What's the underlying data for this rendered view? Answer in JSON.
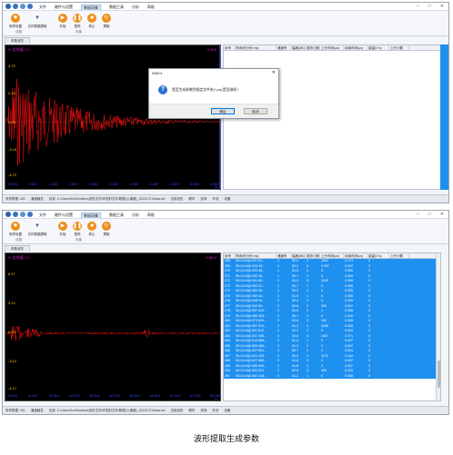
{
  "menus": [
    "文件",
    "硬件与设置",
    "数据采集",
    "数据工具",
    "分析",
    "帮助"
  ],
  "menu_active_index": 2,
  "ribbon_buttons": [
    {
      "label": "采样设置",
      "icon": "gear-icon",
      "color": "#f08c1a"
    },
    {
      "label": "文件数据提取",
      "icon": "filter-icon",
      "color": "#2f5fa8"
    },
    {
      "label": "开始",
      "icon": "play-icon",
      "color": "#f08c1a"
    },
    {
      "label": "暂停",
      "icon": "pause-icon",
      "color": "#f08c1a"
    },
    {
      "label": "停止",
      "icon": "stop-icon",
      "color": "#f08c1a"
    },
    {
      "label": "提取",
      "icon": "extract-icon",
      "color": "#f08c1a"
    }
  ],
  "ribbon_groups": [
    "设置",
    "采集",
    "数据提取"
  ],
  "tab_label": "采集波形",
  "plot1": {
    "legend": "V: 实时值-1.V",
    "header_right": "0.000",
    "y_labels": [
      "4.72",
      "3.15",
      "0.00",
      "-3.15",
      "-4.72"
    ],
    "x_labels": [
      "0.000",
      "0.667",
      "1.333",
      "2.000",
      "2.667",
      "3.333",
      "4.000",
      "4.667",
      "5.333",
      "6.000",
      "6.667"
    ],
    "unit": "ms"
  },
  "plot2": {
    "legend": "V: 实时值-1.V",
    "header_right": "5.88 V",
    "y_labels": [
      "8.17",
      "3.12",
      "0.00",
      "-3.12",
      "-4.17"
    ],
    "x_labels": [
      "0.000",
      "6.400",
      "12.301",
      "19.201",
      "25.601",
      "32.001",
      "38.401",
      "44.801",
      "51.201",
      "57.601",
      "64.001"
    ],
    "unit": "ms"
  },
  "table_headers": [
    "序号",
    "时间(时分秒.ms)",
    "通道号",
    "幅度(dB)",
    "振铃计数",
    "上升时间(us)",
    "持续时间(us)",
    "能量(V·s)",
    "上升计数"
  ],
  "table_rows": [
    [
      "268",
      "05:14:44(0.057 61...",
      "1",
      "52.0",
      "2",
      "1842",
      "0.174",
      "0"
    ],
    [
      "269",
      "05:14:44(0.023 44...",
      "1",
      "52.2",
      "5",
      "0.097",
      "0.097",
      "2"
    ],
    [
      "270",
      "05:14:44(0.032 68...",
      "1",
      "51.6",
      "1",
      "3",
      "0.006",
      "1"
    ],
    [
      "271",
      "05:14:44(0.940 44...",
      "1",
      "50.7",
      "1",
      "0",
      "0.004",
      "0"
    ],
    [
      "272",
      "05:14:44(0.941 89...",
      "1",
      "51.2",
      "5",
      "2243",
      "0.098",
      "2"
    ],
    [
      "273",
      "05:14:44(0.952 61...",
      "1",
      "50.7",
      "1",
      "0",
      "0.006",
      "1"
    ],
    [
      "274",
      "05:14:44(0.953 46...",
      "1",
      "50.3",
      "2",
      "0",
      "0.005",
      "0"
    ],
    [
      "275",
      "05:14:44(0.949 44...",
      "2",
      "51.9",
      "1",
      "0",
      "0.005",
      "0"
    ],
    [
      "276",
      "05:14:44(0.948 94...",
      "2",
      "50.4",
      "2",
      "0",
      "0.005",
      "0"
    ],
    [
      "277",
      "05:14:44(0.949 69...",
      "2",
      "50.8",
      "3",
      "305",
      "0.007",
      "0"
    ],
    [
      "278",
      "05:14:44(0.557 612...",
      "2",
      "51.8",
      "1",
      "1",
      "0.008",
      "0"
    ],
    [
      "279",
      "05:14:44(0.969 463...",
      "2",
      "50.7",
      "1",
      "0",
      "0.010",
      "0"
    ],
    [
      "280",
      "05:14:44(0.573 629...",
      "2",
      "50.8",
      "2",
      "152",
      "0.008",
      "0"
    ],
    [
      "281",
      "05:14:44(0.557 612...",
      "2",
      "51.3",
      "4",
      "1096",
      "0.028",
      "0"
    ],
    [
      "282",
      "05:14:44(0.557 612...",
      "2",
      "51.1",
      "1",
      "0",
      "0.003",
      "0"
    ],
    [
      "283",
      "05:14:44(0.511 498...",
      "2",
      "52.5",
      "5",
      "1807",
      "0.071",
      "0"
    ],
    [
      "284",
      "05:14:44(0.513 689...",
      "2",
      "51.0",
      "1",
      "0",
      "0.007",
      "0"
    ],
    [
      "285",
      "05:14:44(0.599 689...",
      "2",
      "51.2",
      "2",
      "1",
      "0.007",
      "0"
    ],
    [
      "286",
      "05:14:44(0.607 651...",
      "2",
      "50.7",
      "1",
      "3",
      "0.004",
      "0"
    ],
    [
      "287",
      "05:14:44(0.621 443...",
      "2",
      "50.5",
      "4",
      "1170",
      "0.104",
      "2"
    ],
    [
      "288",
      "05:14:44(0.627 680...",
      "2",
      "51.6",
      "1",
      "0",
      "0.007",
      "0"
    ],
    [
      "289",
      "05:14:44(0.556 696...",
      "2",
      "51.6",
      "2",
      "1",
      "0.007",
      "0"
    ],
    [
      "290",
      "05:14:44(0.630 541...",
      "2",
      "52.6",
      "3",
      "305",
      "0.003",
      "0"
    ],
    [
      "291",
      "05:14:44(0.561 418...",
      "2",
      "51.2",
      "1",
      "0",
      "0.006",
      "0"
    ]
  ],
  "status_prefix": "采样数据: 261",
  "status_mode": "通道触发",
  "status_path_label": "目录: C:\\Users\\Arc\\Desktop\\波形文件\\声发射文件\\数据(六通道)_20210721\\data.wd",
  "status_tail": [
    "当前波形",
    "硬件",
    "查询",
    "外设",
    "设备"
  ],
  "dialog": {
    "title": "WAE4",
    "close_glyph": "✕",
    "message": "是否生成参数到指定文件夹(*.pa),是否继续?",
    "ok": "确定",
    "cancel": "取消"
  },
  "caption": "波形提取生成参数"
}
